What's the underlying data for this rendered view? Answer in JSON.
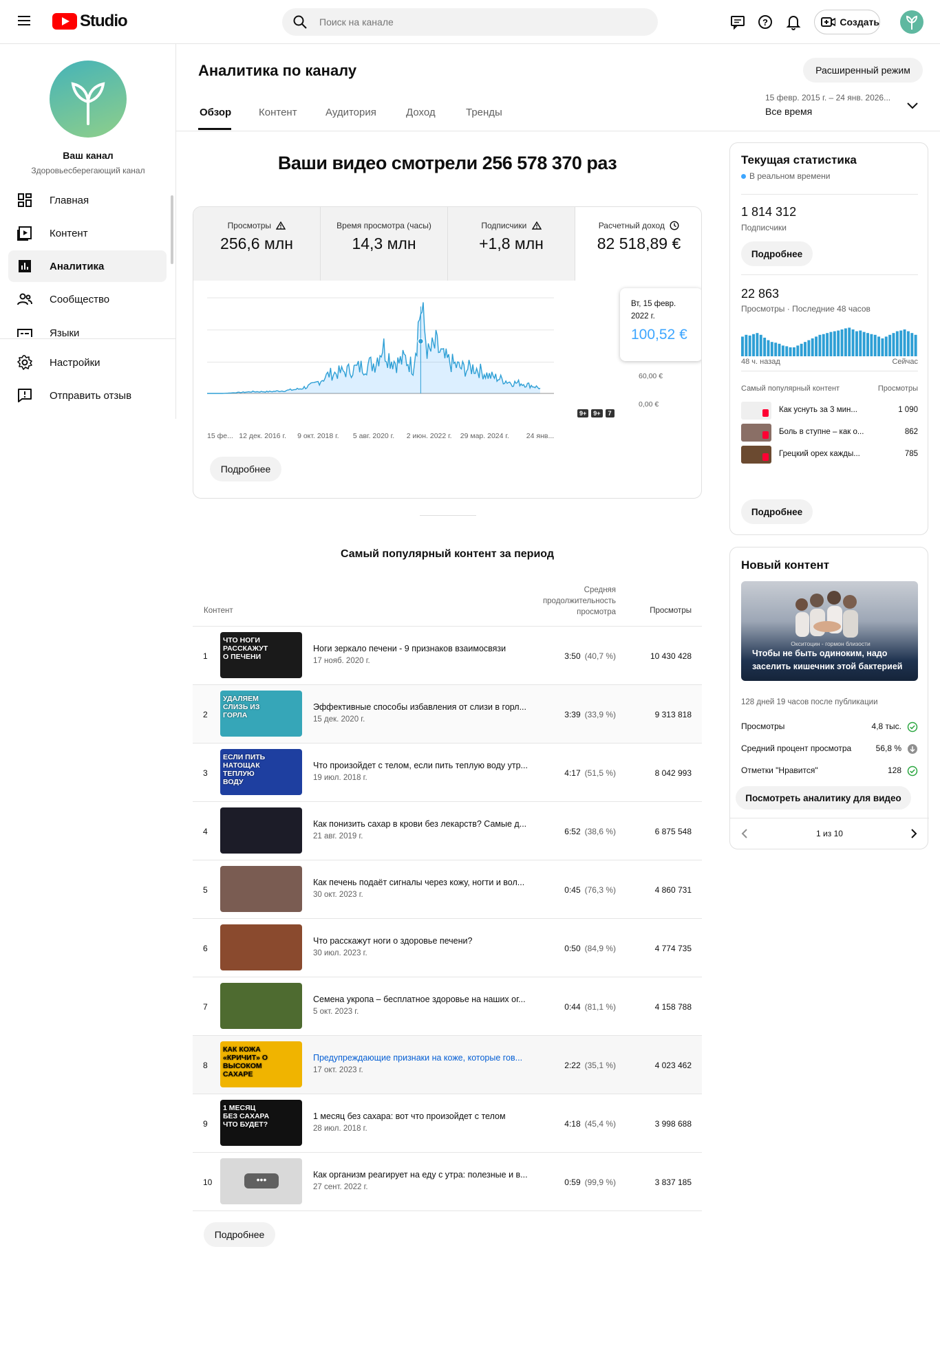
{
  "header": {
    "logo_text": "Studio",
    "search_placeholder": "Поиск на канале",
    "create_label": "Создать"
  },
  "sidebar": {
    "channel_name": "Ваш канал",
    "channel_desc": "Здоровьесберегающий канал",
    "items": [
      {
        "label": "Главная",
        "icon": "dashboard-icon"
      },
      {
        "label": "Контент",
        "icon": "content-icon"
      },
      {
        "label": "Аналитика",
        "icon": "analytics-icon"
      },
      {
        "label": "Сообщество",
        "icon": "community-icon"
      },
      {
        "label": "Языки",
        "icon": "subtitles-icon"
      }
    ],
    "bottom_items": [
      {
        "label": "Настройки",
        "icon": "gear-icon"
      },
      {
        "label": "Отправить отзыв",
        "icon": "feedback-icon"
      }
    ]
  },
  "page": {
    "title": "Аналитика по каналу",
    "advanced_mode": "Расширенный режим",
    "tabs": [
      "Обзор",
      "Контент",
      "Аудитория",
      "Доход",
      "Тренды"
    ],
    "active_tab": 0,
    "date_range": "15 февр. 2015 г. – 24 янв. 2026...",
    "date_preset": "Все время"
  },
  "overview": {
    "headline": "Ваши видео смотрели 256 578 370 раз",
    "metrics": [
      {
        "label": "Просмотры",
        "value": "256,6 млн",
        "icon": "warning-icon"
      },
      {
        "label": "Время просмотра (часы)",
        "value": "14,3 млн",
        "icon": ""
      },
      {
        "label": "Подписчики",
        "value": "+1,8 млн",
        "icon": "warning-icon"
      },
      {
        "label": "Расчетный доход",
        "value": "82 518,89 €",
        "icon": "clock-icon"
      }
    ],
    "tooltip": {
      "date": "Вт, 15 февр. 2022 г.",
      "value": "100,52 €"
    },
    "more_button": "Подробнее",
    "badges": [
      "9+",
      "9+",
      "7"
    ],
    "accent": "#3ea6ff"
  },
  "chart_data": {
    "type": "line",
    "y_tick_labels": [
      "60,00 €",
      "0,00 €"
    ],
    "x_tick_labels": [
      "15 фе...",
      "12 дек. 2016 г.",
      "9 окт. 2018 г.",
      "5 авг. 2020 г.",
      "2 июн. 2022 г.",
      "29 мар. 2024 г.",
      "24 янв..."
    ],
    "x": [
      "2015-02",
      "2015-08",
      "2016-02",
      "2016-08",
      "2017-02",
      "2017-08",
      "2018-02",
      "2018-08",
      "2019-02",
      "2019-08",
      "2020-02",
      "2020-08",
      "2020-11",
      "2021-02",
      "2021-05",
      "2021-08",
      "2021-11",
      "2022-02",
      "2022-05",
      "2022-08",
      "2022-11",
      "2023-02",
      "2023-05",
      "2023-08",
      "2023-11",
      "2024-02",
      "2024-05",
      "2024-08",
      "2024-11",
      "2025-02",
      "2025-05",
      "2025-08",
      "2025-11",
      "2026-01"
    ],
    "values": [
      0,
      0,
      1,
      2,
      2,
      3,
      5,
      10,
      22,
      25,
      30,
      35,
      55,
      40,
      35,
      40,
      30,
      100,
      45,
      55,
      40,
      35,
      30,
      28,
      30,
      25,
      20,
      18,
      15,
      12,
      12,
      10,
      8,
      6
    ],
    "ylim": [
      0,
      110
    ],
    "grid": true
  },
  "top_content": {
    "title": "Самый популярный контент за период",
    "col_content": "Контент",
    "col_duration": "Средняя продолжительность просмотра",
    "col_views": "Просмотры",
    "rows": [
      {
        "n": "1",
        "title": "Ноги зеркало печени - 9 признаков взаимосвязи",
        "date": "17 нояб. 2020 г.",
        "dur": "3:50",
        "pct": "(40,7 %)",
        "views": "10 430 428",
        "thumb_text": "Что ноги расскажут о печени",
        "bg": "#1a1a1a",
        "fg": "#fff"
      },
      {
        "n": "2",
        "title": "Эффективные способы избавления от слизи в горл...",
        "date": "15 дек. 2020 г.",
        "dur": "3:39",
        "pct": "(33,9 %)",
        "views": "9 313 818",
        "thumb_text": "Удаляем слизь из горла",
        "bg": "#36a6b8",
        "fg": "#fff"
      },
      {
        "n": "3",
        "title": "Что произойдет с телом, если пить теплую воду утр...",
        "date": "19 июл. 2018 г.",
        "dur": "4:17",
        "pct": "(51,5 %)",
        "views": "8 042 993",
        "thumb_text": "если пить натощак теплую воду",
        "bg": "#1e3fa0",
        "fg": "#fff"
      },
      {
        "n": "4",
        "title": "Как понизить сахар в крови без лекарств? Самые д...",
        "date": "21 авг. 2019 г.",
        "dur": "6:52",
        "pct": "(38,6 %)",
        "views": "6 875 548",
        "thumb_text": "",
        "bg": "#1c1c28",
        "fg": "#fff"
      },
      {
        "n": "5",
        "title": "Как печень подаёт сигналы через кожу, ногти и вол...",
        "date": "30 окт. 2023 г.",
        "dur": "0:45",
        "pct": "(76,3 %)",
        "views": "4 860 731",
        "thumb_text": "",
        "bg": "#7a5c52",
        "fg": "#fff"
      },
      {
        "n": "6",
        "title": "Что расскажут ноги о здоровье печени?",
        "date": "30 июл. 2023 г.",
        "dur": "0:50",
        "pct": "(84,9 %)",
        "views": "4 774 735",
        "thumb_text": "",
        "bg": "#8a4a2e",
        "fg": "#fff"
      },
      {
        "n": "7",
        "title": "Семена укропа – бесплатное здоровье на наших ог...",
        "date": "5 окт. 2023 г.",
        "dur": "0:44",
        "pct": "(81,1 %)",
        "views": "4 158 788",
        "thumb_text": "",
        "bg": "#4e6b30",
        "fg": "#fff"
      },
      {
        "n": "8",
        "title": "Предупреждающие признаки на коже, которые гов...",
        "date": "17 окт. 2023 г.",
        "dur": "2:22",
        "pct": "(35,1 %)",
        "views": "4 023 462",
        "thumb_text": "как кожа «кричит» о высоком сахаре",
        "bg": "#f0b400",
        "fg": "#000"
      },
      {
        "n": "9",
        "title": "1 месяц без сахара: вот что произойдет с телом",
        "date": "28 июл. 2018 г.",
        "dur": "4:18",
        "pct": "(45,4 %)",
        "views": "3 998 688",
        "thumb_text": "1 месяц без сахара что будет?",
        "bg": "#111",
        "fg": "#fff"
      },
      {
        "n": "10",
        "title": "Как организм реагирует на еду с утра: полезные и в...",
        "date": "27 сент. 2022 г.",
        "dur": "0:59",
        "pct": "(99,9 %)",
        "views": "3 837 185",
        "thumb_text": "",
        "bg": "#d9d9d9",
        "fg": "#fff"
      }
    ],
    "more_button": "Подробнее"
  },
  "realtime": {
    "title": "Текущая статистика",
    "live_label": "В реальном времени",
    "subs_value": "1 814 312",
    "subs_label": "Подписчики",
    "more_button": "Подробнее",
    "views_value": "22 863",
    "views_label": "Просмотры · Последние 48 часов",
    "bars": [
      0.55,
      0.6,
      0.58,
      0.62,
      0.65,
      0.6,
      0.52,
      0.45,
      0.4,
      0.38,
      0.35,
      0.3,
      0.28,
      0.25,
      0.25,
      0.3,
      0.35,
      0.4,
      0.45,
      0.5,
      0.55,
      0.6,
      0.62,
      0.65,
      0.68,
      0.7,
      0.72,
      0.75,
      0.78,
      0.8,
      0.75,
      0.7,
      0.72,
      0.68,
      0.65,
      0.62,
      0.6,
      0.55,
      0.5,
      0.55,
      0.6,
      0.65,
      0.7,
      0.72,
      0.75,
      0.7,
      0.65,
      0.6
    ],
    "bars_left": "48 ч. назад",
    "bars_right": "Сейчас",
    "top_header": "Самый популярный контент",
    "top_header_right": "Просмотры",
    "top": [
      {
        "title": "Как уснуть за 3 мин...",
        "views": "1 090",
        "bg": "#efefef"
      },
      {
        "title": "Боль в ступне – как о...",
        "views": "862",
        "bg": "#8a6f66"
      },
      {
        "title": "Грецкий орех кажды...",
        "views": "785",
        "bg": "#6b4a30"
      }
    ],
    "more_button2": "Подробнее"
  },
  "new_content": {
    "title": "Новый контент",
    "video_title": "Чтобы не быть одиноким, надо заселить кишечник этой бактерией",
    "thumb_overlay": "Окситоцин - гормон близости",
    "since": "128 дней 19 часов после публикации",
    "stats": [
      {
        "label": "Просмотры",
        "value": "4,8 тыс.",
        "icon": "check-circle-icon",
        "color": "#2ba640"
      },
      {
        "label": "Средний процент просмотра",
        "value": "56,8 %",
        "icon": "arrow-down-circle-icon",
        "color": "#909090"
      },
      {
        "label": "Отметки \"Нравится\"",
        "value": "128",
        "icon": "check-circle-icon",
        "color": "#2ba640"
      }
    ],
    "button": "Посмотреть аналитику для видео",
    "pager": "1 из 10"
  }
}
